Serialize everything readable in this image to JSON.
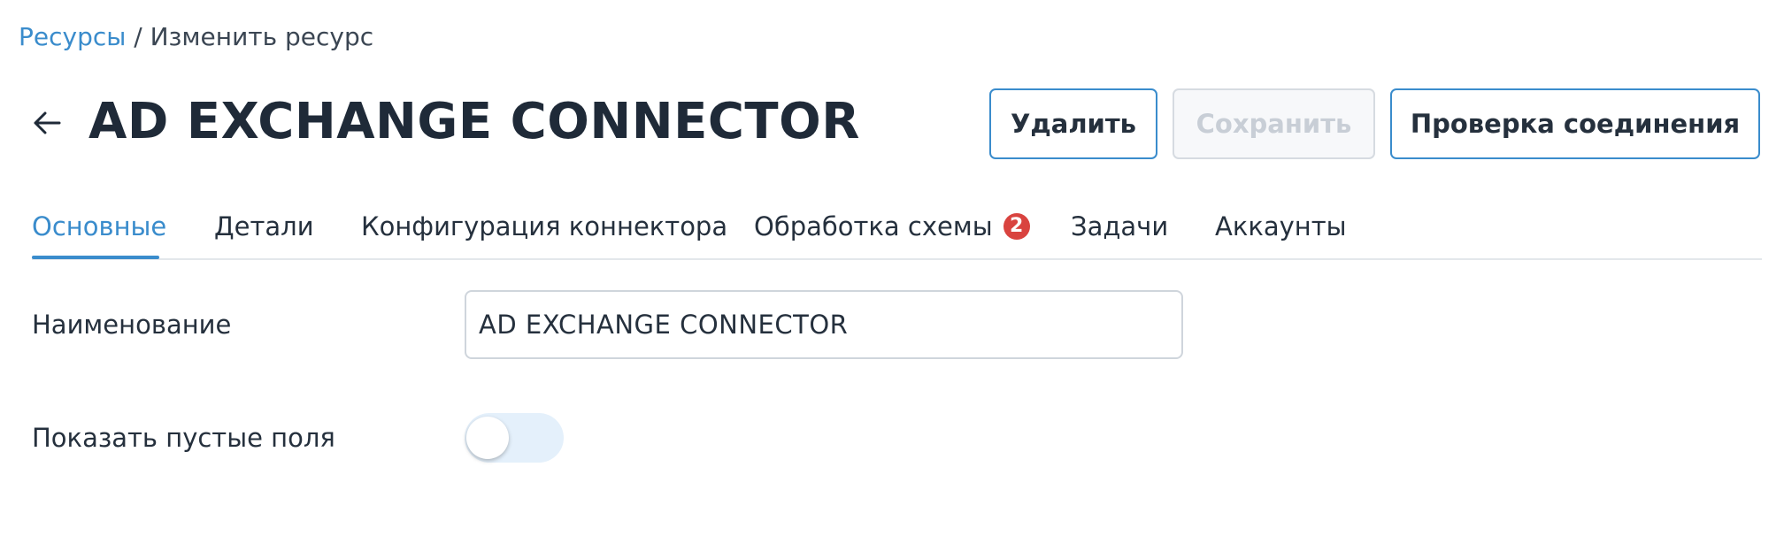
{
  "breadcrumb": {
    "root": "Ресурсы",
    "separator": " / ",
    "current": "Изменить ресурс"
  },
  "header": {
    "title": "AD EXCHANGE CONNECTOR",
    "back_icon": "arrow-left-icon"
  },
  "actions": {
    "delete_label": "Удалить",
    "save_label": "Сохранить",
    "check_label": "Проверка соединения"
  },
  "tabs": [
    {
      "label": "Основные",
      "active": true
    },
    {
      "label": "Детали"
    },
    {
      "label": "Конфигурация коннектора"
    },
    {
      "label": "Обработка схемы",
      "badge": "2"
    },
    {
      "label": "Задачи"
    },
    {
      "label": "Аккаунты"
    }
  ],
  "form": {
    "name_label": "Наименование",
    "name_value": "AD EXCHANGE CONNECTOR",
    "empty_fields_label": "Показать пустые поля",
    "empty_fields_enabled": false
  },
  "colors": {
    "accent": "#3a8ccc",
    "badge": "#d9433f",
    "text": "#25303d",
    "disabled": "#c8ced6"
  }
}
